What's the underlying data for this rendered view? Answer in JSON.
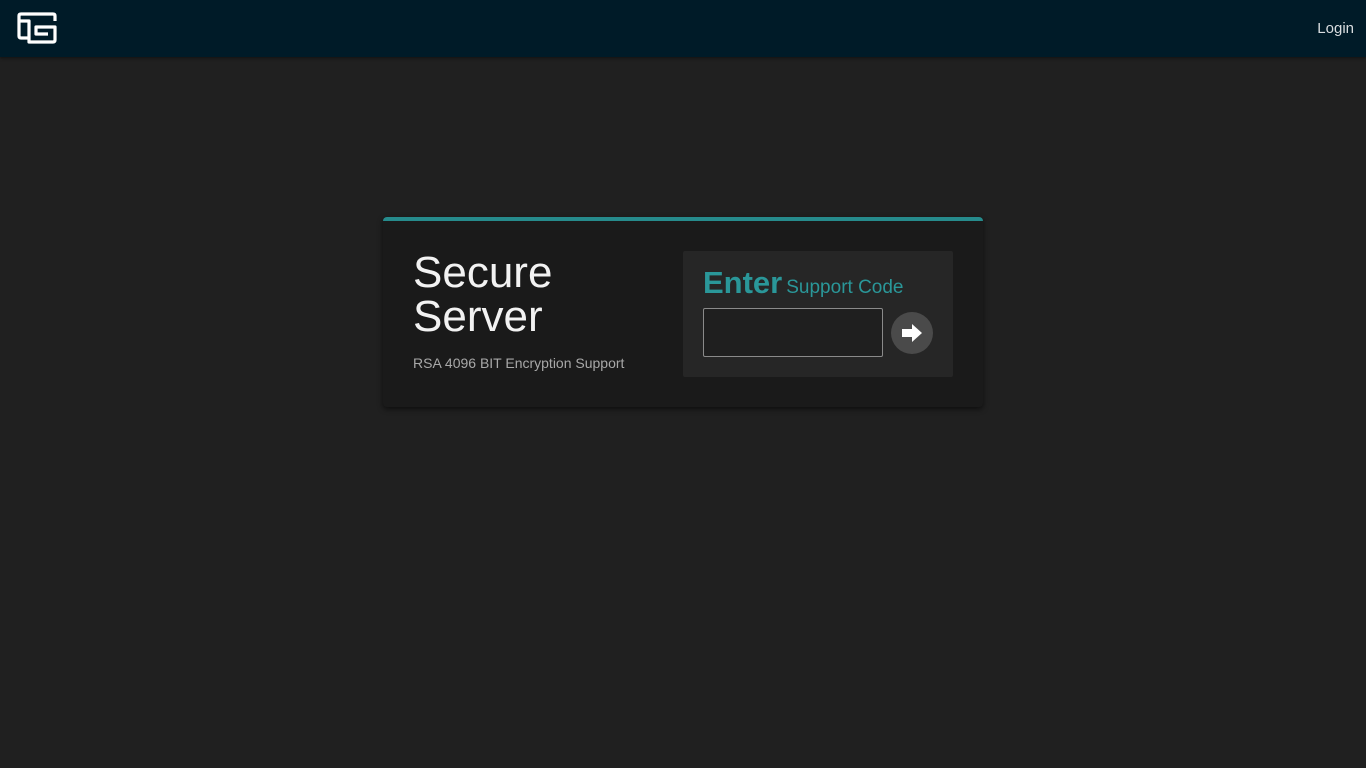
{
  "header": {
    "logo_icon": "terminal-window-icon",
    "login_label": "Login"
  },
  "card": {
    "title_line1": "Secure",
    "title_line2": "Server",
    "subtitle": "RSA 4096 BIT Encryption Support",
    "code_panel": {
      "heading_strong": "Enter",
      "heading_light": "Support Code",
      "input_value": "",
      "input_placeholder": "",
      "submit_icon": "arrow-right-icon"
    }
  },
  "colors": {
    "topbar": "#001b28",
    "background": "#202020",
    "accent": "#268b8c",
    "card": "#1a1a1a",
    "panel": "#262626"
  }
}
